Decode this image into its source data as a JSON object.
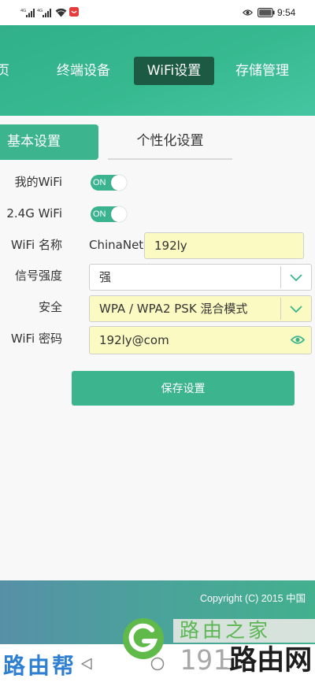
{
  "status_bar": {
    "network_1": "4G",
    "network_2": "4G",
    "time": "9:54"
  },
  "nav": {
    "tabs": [
      {
        "label": "页",
        "active": false
      },
      {
        "label": "终端设备",
        "active": false
      },
      {
        "label": "WiFi设置",
        "active": true
      },
      {
        "label": "存储管理",
        "active": false
      }
    ]
  },
  "sub_tabs": [
    {
      "label": "基本设置",
      "active": true
    },
    {
      "label": "个性化设置",
      "active": false
    }
  ],
  "form": {
    "my_wifi": {
      "label": "我的WiFi",
      "toggle_text": "ON",
      "enabled": true
    },
    "wifi_24g": {
      "label": "2.4G WiFi",
      "toggle_text": "ON",
      "enabled": true
    },
    "wifi_name": {
      "label": "WiFi 名称",
      "prefix": "ChinaNet-",
      "value": "192ly"
    },
    "signal_strength": {
      "label": "信号强度",
      "value": "强"
    },
    "security": {
      "label": "安全",
      "value": "WPA / WPA2 PSK 混合模式"
    },
    "password": {
      "label": "WiFi 密码",
      "value": "192ly@com"
    },
    "save_button": "保存设置"
  },
  "footer": {
    "copyright": "Copyright (C) 2015 中国"
  },
  "watermarks": {
    "logo_text": "路由之家",
    "site_number": "191",
    "site_name": "路由网",
    "corner_text": "路由帮"
  },
  "colors": {
    "primary_green": "#3cb58f",
    "active_nav_tab": "#1c5a44",
    "input_highlight": "#fafac2",
    "watermark_green": "#5cb653",
    "watermark_blue": "#2f7fd3"
  },
  "icons": {
    "status_left": [
      "cellular-signal-icon",
      "cellular-signal-icon",
      "wifi-icon",
      "app-notification-icon"
    ],
    "status_right": [
      "eye-comfort-icon",
      "battery-icon"
    ],
    "select_arrow": "chevron-down-icon",
    "password_toggle": "eye-icon",
    "system_nav": [
      "back-icon",
      "home-icon",
      "recents-icon"
    ]
  }
}
